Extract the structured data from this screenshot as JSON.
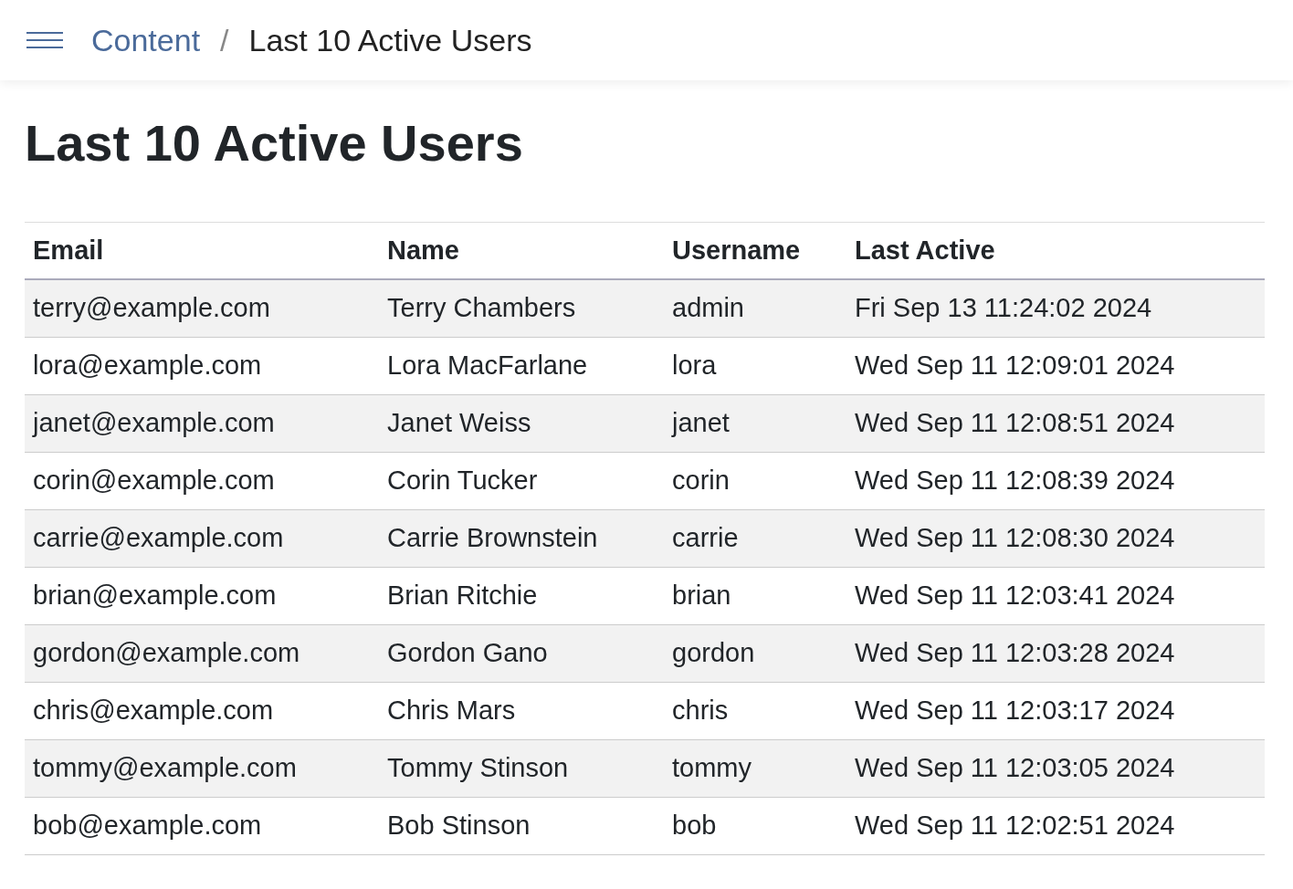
{
  "breadcrumb": {
    "parent": "Content",
    "separator": "/",
    "current": "Last 10 Active Users"
  },
  "heading": "Last 10 Active Users",
  "table": {
    "columns": [
      "Email",
      "Name",
      "Username",
      "Last Active"
    ],
    "rows": [
      [
        "terry@example.com",
        "Terry Chambers",
        "admin",
        "Fri Sep 13 11:24:02 2024"
      ],
      [
        "lora@example.com",
        "Lora MacFarlane",
        "lora",
        "Wed Sep 11 12:09:01 2024"
      ],
      [
        "janet@example.com",
        "Janet Weiss",
        "janet",
        "Wed Sep 11 12:08:51 2024"
      ],
      [
        "corin@example.com",
        "Corin Tucker",
        "corin",
        "Wed Sep 11 12:08:39 2024"
      ],
      [
        "carrie@example.com",
        "Carrie Brownstein",
        "carrie",
        "Wed Sep 11 12:08:30 2024"
      ],
      [
        "brian@example.com",
        "Brian Ritchie",
        "brian",
        "Wed Sep 11 12:03:41 2024"
      ],
      [
        "gordon@example.com",
        "Gordon Gano",
        "gordon",
        "Wed Sep 11 12:03:28 2024"
      ],
      [
        "chris@example.com",
        "Chris Mars",
        "chris",
        "Wed Sep 11 12:03:17 2024"
      ],
      [
        "tommy@example.com",
        "Tommy Stinson",
        "tommy",
        "Wed Sep 11 12:03:05 2024"
      ],
      [
        "bob@example.com",
        "Bob Stinson",
        "bob",
        "Wed Sep 11 12:02:51 2024"
      ]
    ]
  }
}
